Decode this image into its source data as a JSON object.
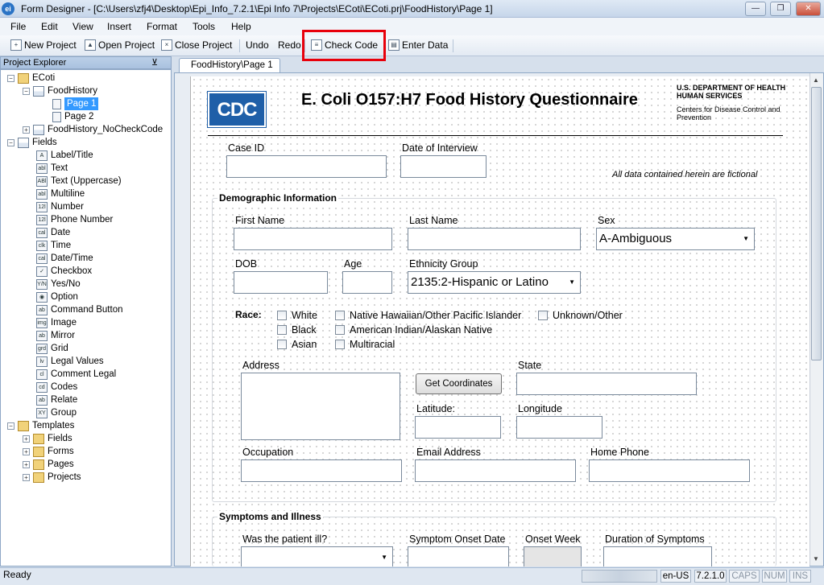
{
  "window": {
    "title": "Form Designer - [C:\\Users\\zfj4\\Desktop\\Epi_Info_7.2.1\\Epi Info 7\\Projects\\ECoti\\ECoti.prj\\FoodHistory\\Page 1]",
    "app_icon": "ei"
  },
  "menu": [
    "File",
    "Edit",
    "View",
    "Insert",
    "Format",
    "Tools",
    "Help"
  ],
  "toolbar": {
    "new_project": "New Project",
    "open_project": "Open Project",
    "close_project": "Close Project",
    "undo": "Undo",
    "redo": "Redo",
    "check_code": "Check Code",
    "enter_data": "Enter Data"
  },
  "highlight_color": "#e8000b",
  "project_explorer": {
    "title": "Project Explorer",
    "tree": {
      "root": "ECoti",
      "form1": "FoodHistory",
      "page1": "Page 1",
      "page2": "Page 2",
      "form2": "FoodHistory_NoCheckCode",
      "fields_header": "Fields",
      "fields": [
        {
          "icon": "A",
          "label": "Label/Title"
        },
        {
          "icon": "abl",
          "label": "Text"
        },
        {
          "icon": "ABl",
          "label": "Text (Uppercase)"
        },
        {
          "icon": "abl",
          "label": "Multiline"
        },
        {
          "icon": "12l",
          "label": "Number"
        },
        {
          "icon": "12l",
          "label": "Phone Number"
        },
        {
          "icon": "cal",
          "label": "Date"
        },
        {
          "icon": "clk",
          "label": "Time"
        },
        {
          "icon": "cal",
          "label": "Date/Time"
        },
        {
          "icon": "✓",
          "label": "Checkbox"
        },
        {
          "icon": "Y/N",
          "label": "Yes/No"
        },
        {
          "icon": "◉",
          "label": "Option"
        },
        {
          "icon": "ab",
          "label": "Command Button"
        },
        {
          "icon": "img",
          "label": "Image"
        },
        {
          "icon": "ab",
          "label": "Mirror"
        },
        {
          "icon": "grd",
          "label": "Grid"
        },
        {
          "icon": "lv",
          "label": "Legal Values"
        },
        {
          "icon": "cl",
          "label": "Comment Legal"
        },
        {
          "icon": "cd",
          "label": "Codes"
        },
        {
          "icon": "ab",
          "label": "Relate"
        },
        {
          "icon": "XY",
          "label": "Group"
        }
      ],
      "templates_header": "Templates",
      "templates": [
        "Fields",
        "Forms",
        "Pages",
        "Projects"
      ]
    }
  },
  "tab": "FoodHistory\\Page 1",
  "form": {
    "logo": "CDC",
    "title": "E. Coli O157:H7 Food History Questionnaire",
    "dept": "U.S. DEPARTMENT OF HEALTH HUMAN SERVICES",
    "cdc_name": "Centers for Disease Control and Prevention",
    "case_id": "Case ID",
    "date_of_interview": "Date of Interview",
    "fictional_note": "All data contained herein are fictional",
    "demographic": {
      "title": "Demographic Information",
      "first_name": "First Name",
      "last_name": "Last Name",
      "sex": "Sex",
      "sex_value": "A-Ambiguous",
      "dob": "DOB",
      "age": "Age",
      "ethnicity": "Ethnicity Group",
      "ethnicity_value": "2135:2-Hispanic or Latino",
      "race_label": "Race:",
      "race_options": [
        "White",
        "Black",
        "Asian",
        "Native Hawaiian/Other Pacific Islander",
        "American Indian/Alaskan Native",
        "Multiracial",
        "Unknown/Other"
      ],
      "address": "Address",
      "get_coordinates": "Get Coordinates",
      "state": "State",
      "latitude": "Latitude:",
      "longitude": "Longitude",
      "occupation": "Occupation",
      "email": "Email Address",
      "home_phone": "Home Phone"
    },
    "symptoms": {
      "title": "Symptoms and Illness",
      "was_ill": "Was the patient ill?",
      "onset_date": "Symptom Onset Date",
      "onset_week": "Onset Week",
      "duration": "Duration of Symptoms"
    }
  },
  "status": {
    "ready": "Ready",
    "locale": "en-US",
    "version": "7.2.1.0",
    "caps": "CAPS",
    "num": "NUM",
    "ins": "INS"
  }
}
